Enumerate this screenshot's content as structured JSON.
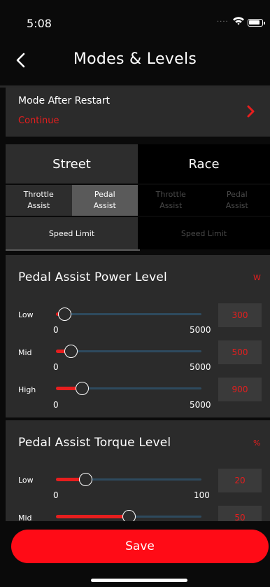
{
  "status_bar": {
    "time": "5:08",
    "signal": "····"
  },
  "nav": {
    "title": "Modes & Levels"
  },
  "restart": {
    "label": "Mode After Restart",
    "value": "Continue"
  },
  "tabs": [
    {
      "label": "Street"
    },
    {
      "label": "Race"
    }
  ],
  "subtabs": [
    {
      "label": "Throttle\nAssist"
    },
    {
      "label": "Pedal\nAssist"
    },
    {
      "label": "Throttle\nAssist"
    },
    {
      "label": "Pedal\nAssist"
    }
  ],
  "speed_tabs": [
    {
      "label": "Speed Limit"
    },
    {
      "label": "Speed Limit"
    }
  ],
  "power": {
    "title": "Pedal Assist Power Level",
    "unit": "W",
    "levels": [
      {
        "label": "Low",
        "min": "0",
        "max": "5000",
        "value": "300",
        "fraction": 0.06
      },
      {
        "label": "Mid",
        "min": "0",
        "max": "5000",
        "value": "500",
        "fraction": 0.1
      },
      {
        "label": "High",
        "min": "0",
        "max": "5000",
        "value": "900",
        "fraction": 0.18
      }
    ]
  },
  "torque": {
    "title": "Pedal Assist Torque Level",
    "unit": "%",
    "levels": [
      {
        "label": "Low",
        "min": "0",
        "max": "100",
        "value": "20",
        "fraction": 0.2
      },
      {
        "label": "Mid",
        "value": "50",
        "fraction": 0.5
      }
    ]
  },
  "save_label": "Save",
  "colors": {
    "accent": "#e61e1e",
    "track": "#2e4a5e",
    "card": "#2b2b2b"
  }
}
